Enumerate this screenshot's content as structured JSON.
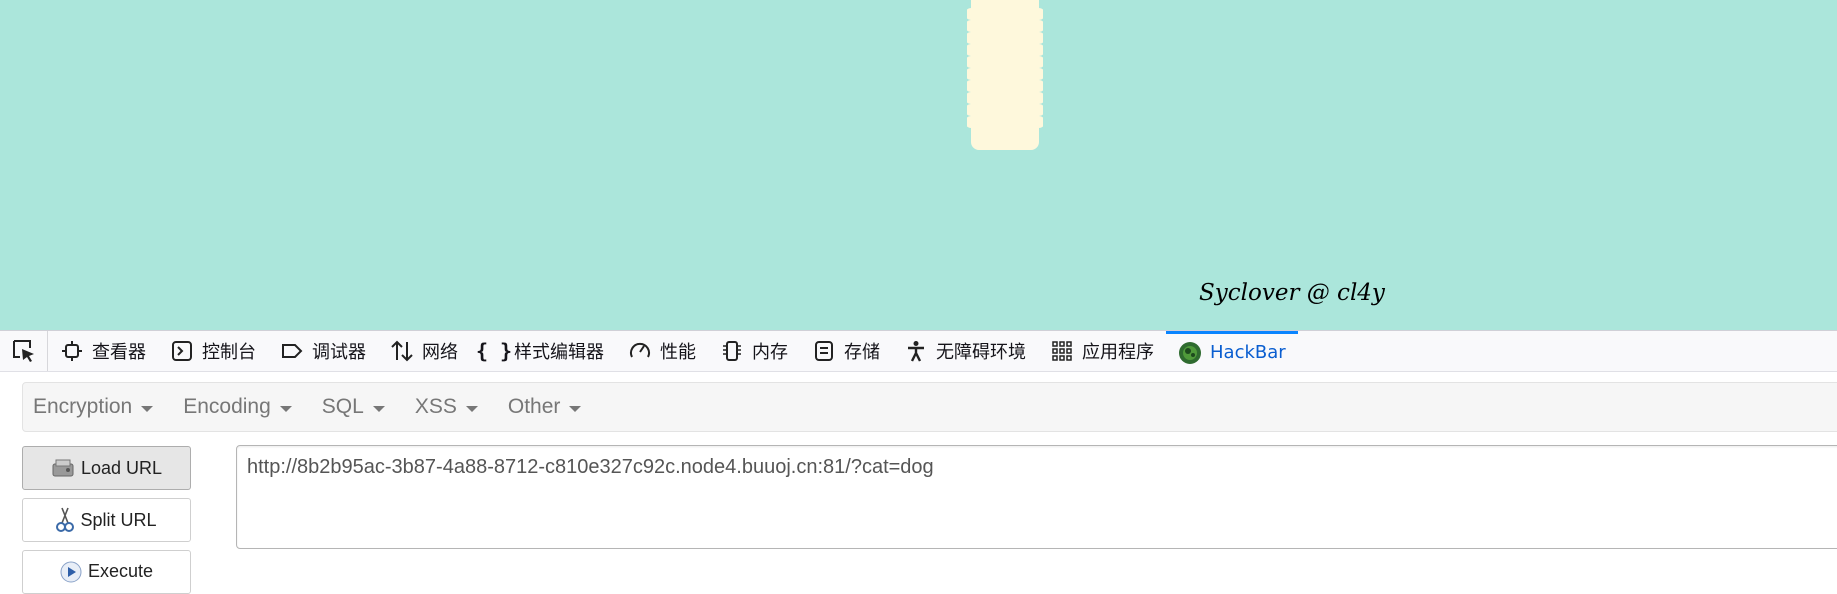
{
  "page": {
    "signature": "Syclover @ cl4y",
    "background_color": "#abe6db",
    "cat_color": "#fef8dc"
  },
  "devtools": {
    "picker_icon": "element-picker-icon",
    "tabs": [
      {
        "label": "查看器",
        "icon": "inspector-icon"
      },
      {
        "label": "控制台",
        "icon": "console-icon"
      },
      {
        "label": "调试器",
        "icon": "debugger-icon"
      },
      {
        "label": "网络",
        "icon": "network-icon"
      },
      {
        "label": "样式编辑器",
        "icon": "style-editor-icon"
      },
      {
        "label": "性能",
        "icon": "performance-icon"
      },
      {
        "label": "内存",
        "icon": "memory-icon"
      },
      {
        "label": "存储",
        "icon": "storage-icon"
      },
      {
        "label": "无障碍环境",
        "icon": "accessibility-icon"
      },
      {
        "label": "应用程序",
        "icon": "application-icon"
      },
      {
        "label": "HackBar",
        "icon": "hackbar-icon",
        "active": true
      }
    ],
    "active_color": "#0a84ff"
  },
  "hackbar": {
    "menus": [
      "Encryption",
      "Encoding",
      "SQL",
      "XSS",
      "Other"
    ],
    "load_url_label": "Load URL",
    "split_url_label": "Split URL",
    "execute_label": "Execute",
    "url_value": "http://8b2b95ac-3b87-4a88-8712-c810e327c92c.node4.buuoj.cn:81/?cat=dog"
  }
}
